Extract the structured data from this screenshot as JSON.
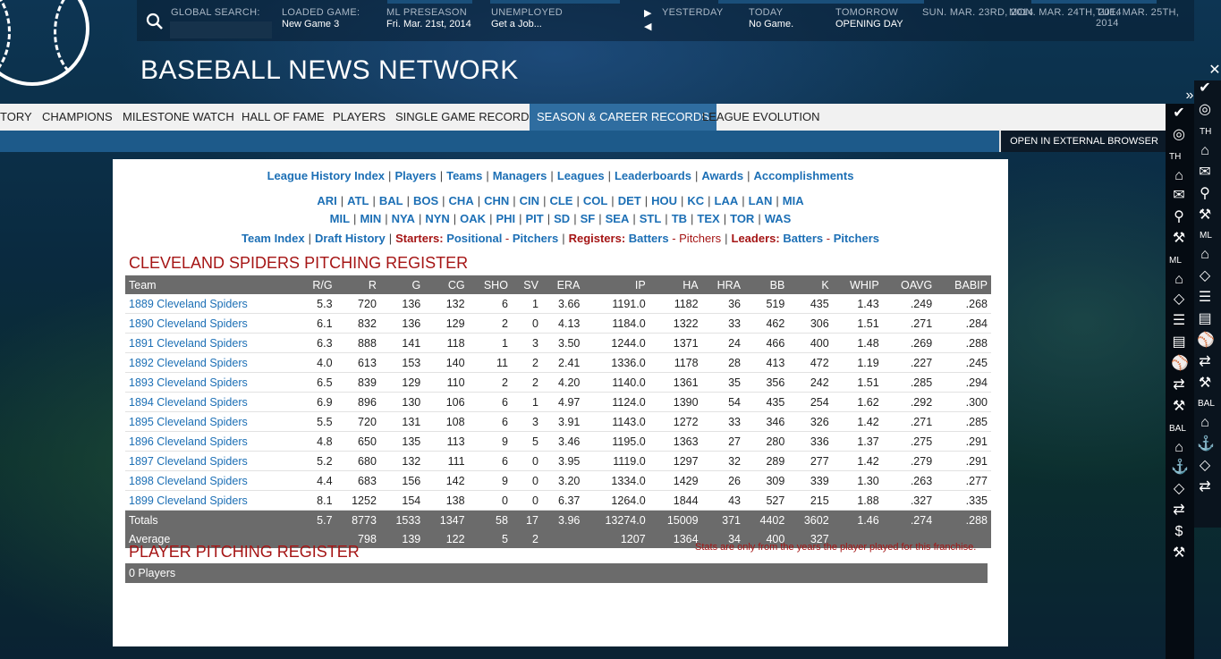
{
  "topbar": {
    "search_label": "GLOBAL SEARCH:",
    "loaded_game_label": "LOADED GAME:",
    "loaded_game_value": "New Game 3",
    "phase_label": "ML PRESEASON",
    "phase_value": "Fri. Mar. 21st, 2014",
    "status_label": "UNEMPLOYED",
    "status_value": "Get a Job...",
    "yesterday_label": "YESTERDAY",
    "today_label": "TODAY",
    "today_value": "No Game.",
    "tomorrow_label": "TOMORROW",
    "tomorrow_value": "OPENING DAY",
    "dates": [
      "SUN. MAR. 23RD, 2014",
      "MON. MAR. 24TH, 2014",
      "TUE. MAR. 25TH, 2014"
    ]
  },
  "site_title": "BASEBALL NEWS NETWORK",
  "tabs": [
    "TORY",
    "CHAMPIONS",
    "MILESTONE WATCH",
    "HALL OF FAME",
    "PLAYERS",
    "SINGLE GAME RECORDS",
    "SEASON & CAREER RECORDS",
    "LEAGUE EVOLUTION"
  ],
  "external_button": "OPEN IN EXTERNAL BROWSER",
  "nav_links": [
    "League History Index",
    "Players",
    "Teams",
    "Managers",
    "Leagues",
    "Leaderboards",
    "Awards",
    "Accomplishments"
  ],
  "team_links_row1": [
    "ARI",
    "ATL",
    "BAL",
    "BOS",
    "CHA",
    "CHN",
    "CIN",
    "CLE",
    "COL",
    "DET",
    "HOU",
    "KC",
    "LAA",
    "LAN",
    "MIA"
  ],
  "team_links_row2": [
    "MIL",
    "MIN",
    "NYA",
    "NYN",
    "OAK",
    "PHI",
    "PIT",
    "SD",
    "SF",
    "SEA",
    "STL",
    "TB",
    "TEX",
    "TOR",
    "WAS"
  ],
  "sub_links": {
    "team_index": "Team Index",
    "draft_history": "Draft History",
    "starters_label": "Starters:",
    "positional": "Positional",
    "pitchers": "Pitchers",
    "registers_label": "Registers:",
    "batters": "Batters",
    "reg_pitchers": "Pitchers",
    "leaders_label": "Leaders:",
    "leaders_batters": "Batters",
    "leaders_pitchers": "Pitchers"
  },
  "register_title": "CLEVELAND SPIDERS PITCHING REGISTER",
  "columns": [
    "Team",
    "R/G",
    "R",
    "G",
    "CG",
    "SHO",
    "SV",
    "ERA",
    "IP",
    "HA",
    "HRA",
    "BB",
    "K",
    "WHIP",
    "OAVG",
    "BABIP"
  ],
  "rows": [
    [
      "1889 Cleveland Spiders",
      "5.3",
      "720",
      "136",
      "132",
      "6",
      "1",
      "3.66",
      "1191.0",
      "1182",
      "36",
      "519",
      "435",
      "1.43",
      ".249",
      ".268"
    ],
    [
      "1890 Cleveland Spiders",
      "6.1",
      "832",
      "136",
      "129",
      "2",
      "0",
      "4.13",
      "1184.0",
      "1322",
      "33",
      "462",
      "306",
      "1.51",
      ".271",
      ".284"
    ],
    [
      "1891 Cleveland Spiders",
      "6.3",
      "888",
      "141",
      "118",
      "1",
      "3",
      "3.50",
      "1244.0",
      "1371",
      "24",
      "466",
      "400",
      "1.48",
      ".269",
      ".288"
    ],
    [
      "1892 Cleveland Spiders",
      "4.0",
      "613",
      "153",
      "140",
      "11",
      "2",
      "2.41",
      "1336.0",
      "1178",
      "28",
      "413",
      "472",
      "1.19",
      ".227",
      ".245"
    ],
    [
      "1893 Cleveland Spiders",
      "6.5",
      "839",
      "129",
      "110",
      "2",
      "2",
      "4.20",
      "1140.0",
      "1361",
      "35",
      "356",
      "242",
      "1.51",
      ".285",
      ".294"
    ],
    [
      "1894 Cleveland Spiders",
      "6.9",
      "896",
      "130",
      "106",
      "6",
      "1",
      "4.97",
      "1124.0",
      "1390",
      "54",
      "435",
      "254",
      "1.62",
      ".292",
      ".300"
    ],
    [
      "1895 Cleveland Spiders",
      "5.5",
      "720",
      "131",
      "108",
      "6",
      "3",
      "3.91",
      "1143.0",
      "1272",
      "33",
      "346",
      "326",
      "1.42",
      ".271",
      ".285"
    ],
    [
      "1896 Cleveland Spiders",
      "4.8",
      "650",
      "135",
      "113",
      "9",
      "5",
      "3.46",
      "1195.0",
      "1363",
      "27",
      "280",
      "336",
      "1.37",
      ".275",
      ".291"
    ],
    [
      "1897 Cleveland Spiders",
      "5.2",
      "680",
      "132",
      "111",
      "6",
      "0",
      "3.95",
      "1119.0",
      "1297",
      "32",
      "289",
      "277",
      "1.42",
      ".279",
      ".291"
    ],
    [
      "1898 Cleveland Spiders",
      "4.4",
      "683",
      "156",
      "142",
      "9",
      "0",
      "3.20",
      "1334.0",
      "1429",
      "26",
      "309",
      "339",
      "1.30",
      ".263",
      ".277"
    ],
    [
      "1899 Cleveland Spiders",
      "8.1",
      "1252",
      "154",
      "138",
      "0",
      "0",
      "6.37",
      "1264.0",
      "1844",
      "43",
      "527",
      "215",
      "1.88",
      ".327",
      ".335"
    ]
  ],
  "totals": [
    "Totals",
    "5.7",
    "8773",
    "1533",
    "1347",
    "58",
    "17",
    "3.96",
    "13274.0",
    "15009",
    "371",
    "4402",
    "3602",
    "1.46",
    ".274",
    ".288"
  ],
  "average": [
    "Average",
    "",
    "798",
    "139",
    "122",
    "5",
    "2",
    "",
    "1207",
    "1364",
    "34",
    "400",
    "327",
    "",
    "",
    ""
  ],
  "player_register_title": "PLAYER PITCHING REGISTER",
  "player_note": "Stats are only from the years the player played for this franchise.",
  "players_count": "0 Players",
  "sidebar": {
    "labels": [
      "TH",
      "TH",
      "ML",
      "ML",
      "BAL",
      "BAL"
    ]
  }
}
